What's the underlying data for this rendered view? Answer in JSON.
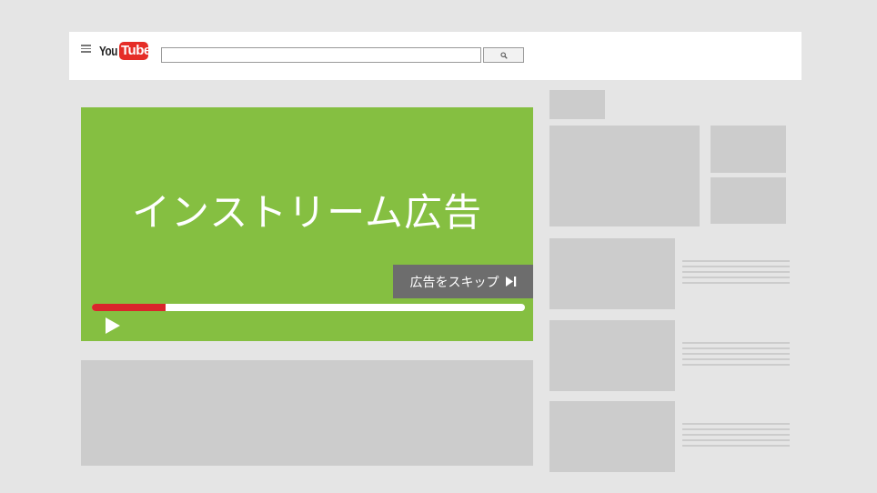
{
  "header": {
    "logo_you": "You",
    "logo_tube": "Tube",
    "search_value": "",
    "menu_icon": "hamburger-icon",
    "search_icon": "magnifier-icon"
  },
  "player": {
    "title": "インストリーム広告",
    "skip_label": "広告をスキップ",
    "skip_icon": "skip-next-icon",
    "play_icon": "play-icon",
    "progress": 0.17,
    "colors": {
      "background": "#85bf41",
      "progress": "#d9262b",
      "skip_bg": "#6d6d6d"
    }
  }
}
